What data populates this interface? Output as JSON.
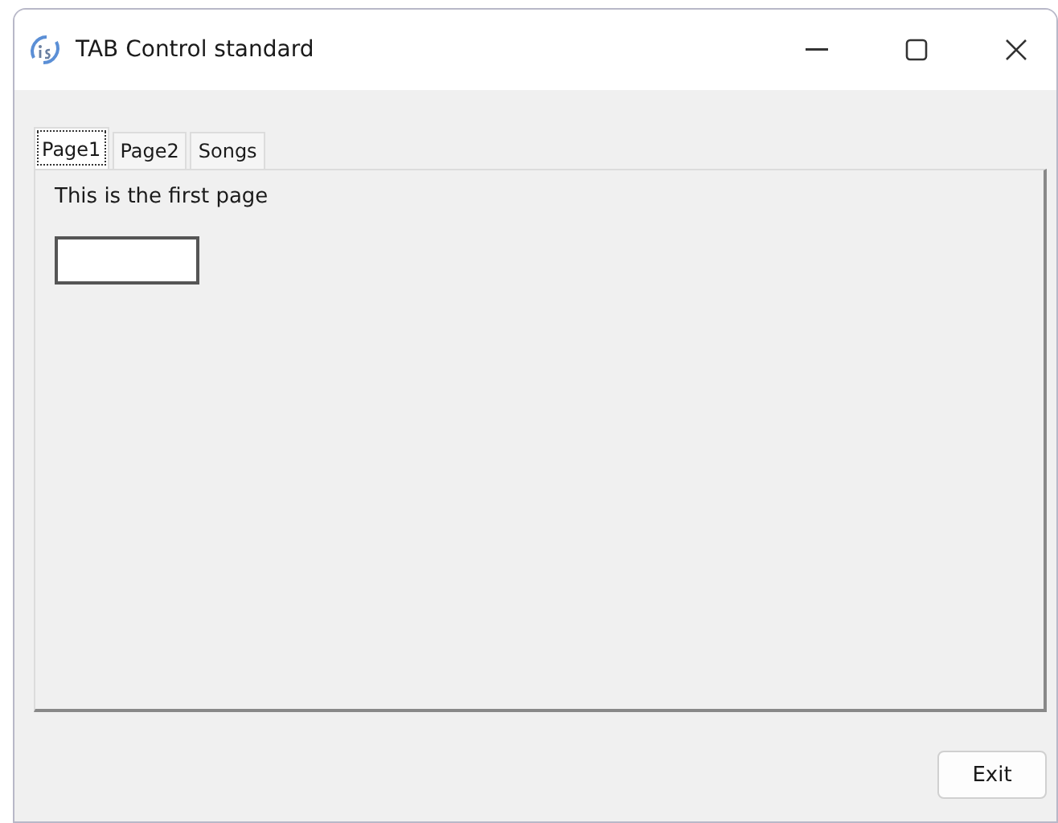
{
  "window": {
    "title": "TAB Control standard"
  },
  "tabs": [
    {
      "label": "Page1",
      "selected": true
    },
    {
      "label": "Page2",
      "selected": false
    },
    {
      "label": "Songs",
      "selected": false
    }
  ],
  "page": {
    "text": "This is the first page"
  },
  "buttons": [
    "Exit"
  ]
}
